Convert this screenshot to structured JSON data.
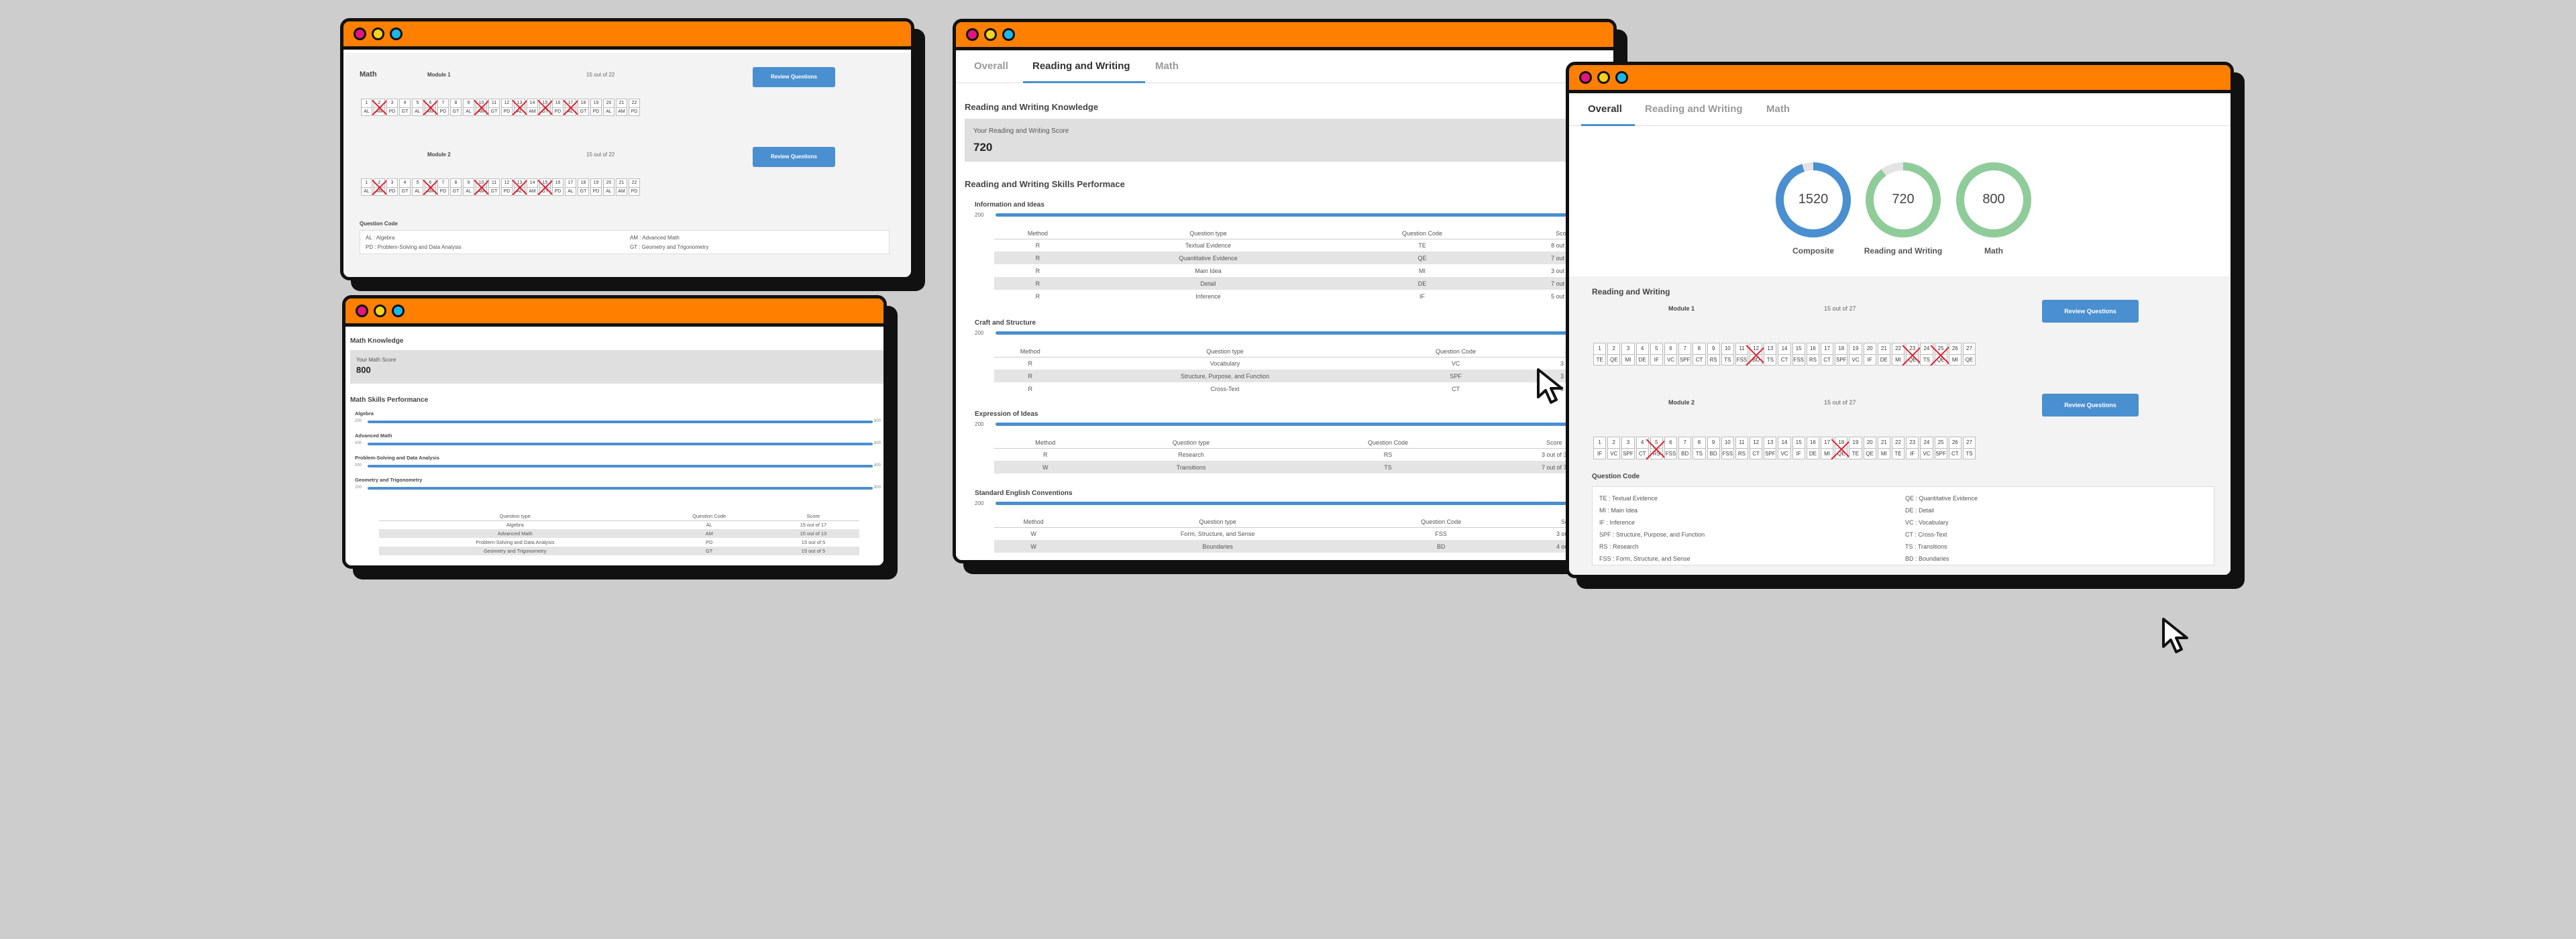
{
  "math_window": {
    "section_title": "Math",
    "modules": [
      {
        "title": "Module 1",
        "score": "15 out of 22",
        "button": "Review Questions",
        "numbers": [
          "1",
          "2",
          "3",
          "4",
          "5",
          "6",
          "7",
          "8",
          "9",
          "10",
          "11",
          "12",
          "13",
          "14",
          "15",
          "16",
          "17",
          "18",
          "19",
          "20",
          "21",
          "22"
        ],
        "codes": [
          "AL",
          "AM",
          "PD",
          "GT",
          "AL",
          "AM",
          "PD",
          "GT",
          "AL",
          "AM",
          "GT",
          "PD",
          "AL",
          "AM",
          "GT",
          "PD",
          "AL",
          "GT",
          "PD",
          "AL",
          "AM",
          "PD"
        ],
        "wrong": [
          2,
          6,
          10,
          13,
          15,
          17
        ]
      },
      {
        "title": "Module 2",
        "score": "15 out of 22",
        "button": "Review Questions",
        "numbers": [
          "1",
          "2",
          "3",
          "4",
          "5",
          "6",
          "7",
          "8",
          "9",
          "10",
          "11",
          "12",
          "13",
          "14",
          "15",
          "16",
          "17",
          "18",
          "19",
          "20",
          "21",
          "22"
        ],
        "codes": [
          "AL",
          "AM",
          "PD",
          "GT",
          "AL",
          "AM",
          "PD",
          "GT",
          "AL",
          "AM",
          "GT",
          "PD",
          "AL",
          "AM",
          "GT",
          "PD",
          "AL",
          "GT",
          "PD",
          "AL",
          "AM",
          "PD"
        ],
        "wrong": [
          2,
          6,
          10,
          13,
          15
        ]
      }
    ],
    "code_title": "Question Code",
    "code_items": [
      "AL : Algebra",
      "AM : Advanced Math",
      "PD : Problem-Solving and Data Analysis",
      "GT : Geometry and Trigonometry"
    ]
  },
  "math_knowledge_window": {
    "title": "Math Knowledge",
    "score_label": "Your Math Score",
    "score": "800",
    "perf_title": "Math Skills Performance",
    "skills": [
      {
        "name": "Algebra",
        "min": "200",
        "max": "800",
        "fraction": 1.0
      },
      {
        "name": "Advanced Math",
        "min": "200",
        "max": "800",
        "fraction": 1.0
      },
      {
        "name": "Problem-Solving and Data Analysis",
        "min": "200",
        "max": "800",
        "fraction": 1.0
      },
      {
        "name": "Geometry and Trigonometry",
        "min": "200",
        "max": "800",
        "fraction": 1.0
      }
    ],
    "table_headers": [
      "Question type",
      "Question Code",
      "Score"
    ],
    "table_rows": [
      [
        "Algebra",
        "AL",
        "15 out of 17"
      ],
      [
        "Advanced Math",
        "AM",
        "15 out of 13"
      ],
      [
        "Problem-Solving and Data Analysis",
        "PD",
        "15 out of 5"
      ],
      [
        "Geometry and Trigonometry",
        "GT",
        "15 out of 5"
      ]
    ]
  },
  "rw_window": {
    "tabs": [
      "Overall",
      "Reading and Writing",
      "Math"
    ],
    "active_tab": "Reading and Writing",
    "knowledge_title": "Reading and Writing Knowledge",
    "score_label": "Your Reading and Writing Score",
    "score": "720",
    "perf_title": "Reading and Writing Skills Performace",
    "table_headers": [
      "Method",
      "Question type",
      "Question Code",
      "Score"
    ],
    "sections": [
      {
        "title": "Information and Ideas",
        "min": "200",
        "rows": [
          [
            "R",
            "Textual Evidence",
            "TE",
            "8 out of 6"
          ],
          [
            "R",
            "Quantitative Evidence",
            "QE",
            "7 out of 7"
          ],
          [
            "R",
            "Main Idea",
            "MI",
            "3 out of 4"
          ],
          [
            "R",
            "Detail",
            "DE",
            "7 out of 8"
          ],
          [
            "R",
            "Inference",
            "IF",
            "5 out of 9"
          ]
        ]
      },
      {
        "title": "Craft and Structure",
        "min": "200",
        "rows": [
          [
            "R",
            "Vocabulary",
            "VC",
            "3 out of 3"
          ],
          [
            "R",
            "Structure, Purpose, and Function",
            "SPF",
            "3 out of 4"
          ],
          [
            "R",
            "Cross-Text",
            "CT",
            "3 out of 4"
          ]
        ]
      },
      {
        "title": "Expression of Ideas",
        "min": "200",
        "rows": [
          [
            "R",
            "Research",
            "RS",
            "3 out of 3"
          ],
          [
            "W",
            "Transitions",
            "TS",
            "7 out of 7"
          ]
        ]
      },
      {
        "title": "Standard English Conventions",
        "min": "200",
        "rows": [
          [
            "W",
            "Form, Structure, and Sense",
            "FSS",
            "3 out of 2"
          ],
          [
            "W",
            "Boundaries",
            "BD",
            "4 out of 4"
          ]
        ]
      }
    ]
  },
  "overall_window": {
    "tabs": [
      "Overall",
      "Reading and Writing",
      "Math"
    ],
    "active_tab": "Overall",
    "rings": [
      {
        "value": "1520",
        "label": "Composite",
        "color": "#4a8fd0",
        "fraction": 0.95
      },
      {
        "value": "720",
        "label": "Reading and Writing",
        "color": "#8fcc9a",
        "fraction": 0.9
      },
      {
        "value": "800",
        "label": "Math",
        "color": "#8fcc9a",
        "fraction": 1.0
      }
    ],
    "section_title": "Reading and Writing",
    "modules": [
      {
        "title": "Module 1",
        "score": "15 out of 27",
        "button": "Review Questions",
        "numbers": [
          "1",
          "2",
          "3",
          "4",
          "5",
          "6",
          "7",
          "8",
          "9",
          "10",
          "11",
          "12",
          "13",
          "14",
          "15",
          "16",
          "17",
          "18",
          "19",
          "20",
          "21",
          "22",
          "23",
          "24",
          "25",
          "26",
          "27"
        ],
        "codes": [
          "TE",
          "QE",
          "MI",
          "DE",
          "IF",
          "VC",
          "SPF",
          "CT",
          "RS",
          "TS",
          "FSS",
          "BD",
          "TS",
          "CT",
          "FSS",
          "RS",
          "CT",
          "SPF",
          "VC",
          "IF",
          "DE",
          "MI",
          "QE",
          "TS",
          "QE",
          "MI",
          "QE"
        ],
        "wrong": [
          12,
          23,
          25
        ]
      },
      {
        "title": "Module 2",
        "score": "15 out of 27",
        "button": "Review Questions",
        "numbers": [
          "1",
          "2",
          "3",
          "4",
          "5",
          "6",
          "7",
          "8",
          "9",
          "10",
          "11",
          "12",
          "13",
          "14",
          "15",
          "16",
          "17",
          "18",
          "19",
          "20",
          "21",
          "22",
          "23",
          "24",
          "25",
          "26",
          "27"
        ],
        "codes": [
          "IF",
          "VC",
          "SPF",
          "CT",
          "RS",
          "FSS",
          "BD",
          "TS",
          "BD",
          "FSS",
          "RS",
          "CT",
          "SPF",
          "VC",
          "IF",
          "DE",
          "MI",
          "QE",
          "TE",
          "QE",
          "MI",
          "TE",
          "IF",
          "VC",
          "SPF",
          "CT",
          "TS"
        ],
        "wrong": [
          5,
          18
        ]
      }
    ],
    "code_title": "Question Code",
    "code_items": [
      "TE : Textual Evidence",
      "QE : Quantitative Evidence",
      "MI : Main Idea",
      "DE : Detail",
      "IF : Inference",
      "VC : Vocabulary",
      "SPF : Structure, Purpose, and Function",
      "CT : Cross-Text",
      "RS : Research",
      "TS : Transitions",
      "FSS : Form, Structure, and Sense",
      "BD : Boundaries"
    ]
  }
}
